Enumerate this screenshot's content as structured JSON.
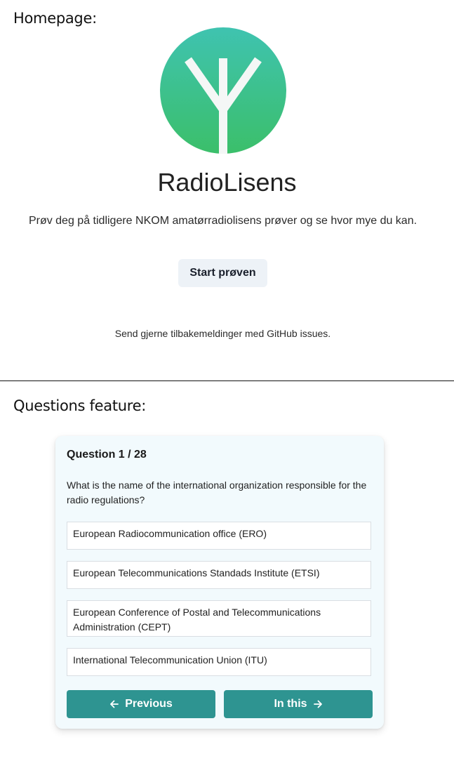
{
  "sections": {
    "homepage_heading": "Homepage:",
    "questions_heading": "Questions feature:"
  },
  "homepage": {
    "logo_icon": "antenna-y-logo-icon",
    "app_title": "RadioLisens",
    "tagline": "Prøv deg på tidligere NKOM amatørradiolisens prøver og se hvor mye du kan.",
    "start_button_label": "Start prøven",
    "feedback_text": "Send gjerne tilbakemeldinger med GitHub issues."
  },
  "quiz": {
    "counter": "Question 1 / 28",
    "question": "What is the name of the international organization responsible for the radio regulations?",
    "options": [
      "European Radiocommunication office (ERO)",
      "European Telecommunications Standads Institute (ETSI)",
      "European Conference of Postal and Telecommunications Administration (CEPT)",
      "International Telecommunication Union (ITU)"
    ],
    "previous_label": "Previous",
    "next_label": "In this",
    "previous_icon": "arrow-left-icon",
    "next_icon": "arrow-right-icon"
  },
  "colors": {
    "logo_gradient_top": "#3fc3b0",
    "logo_gradient_bottom": "#3bbf6a",
    "button_teal": "#2e9491",
    "card_background": "#f2fafd",
    "start_button_bg": "#edf2f7"
  }
}
